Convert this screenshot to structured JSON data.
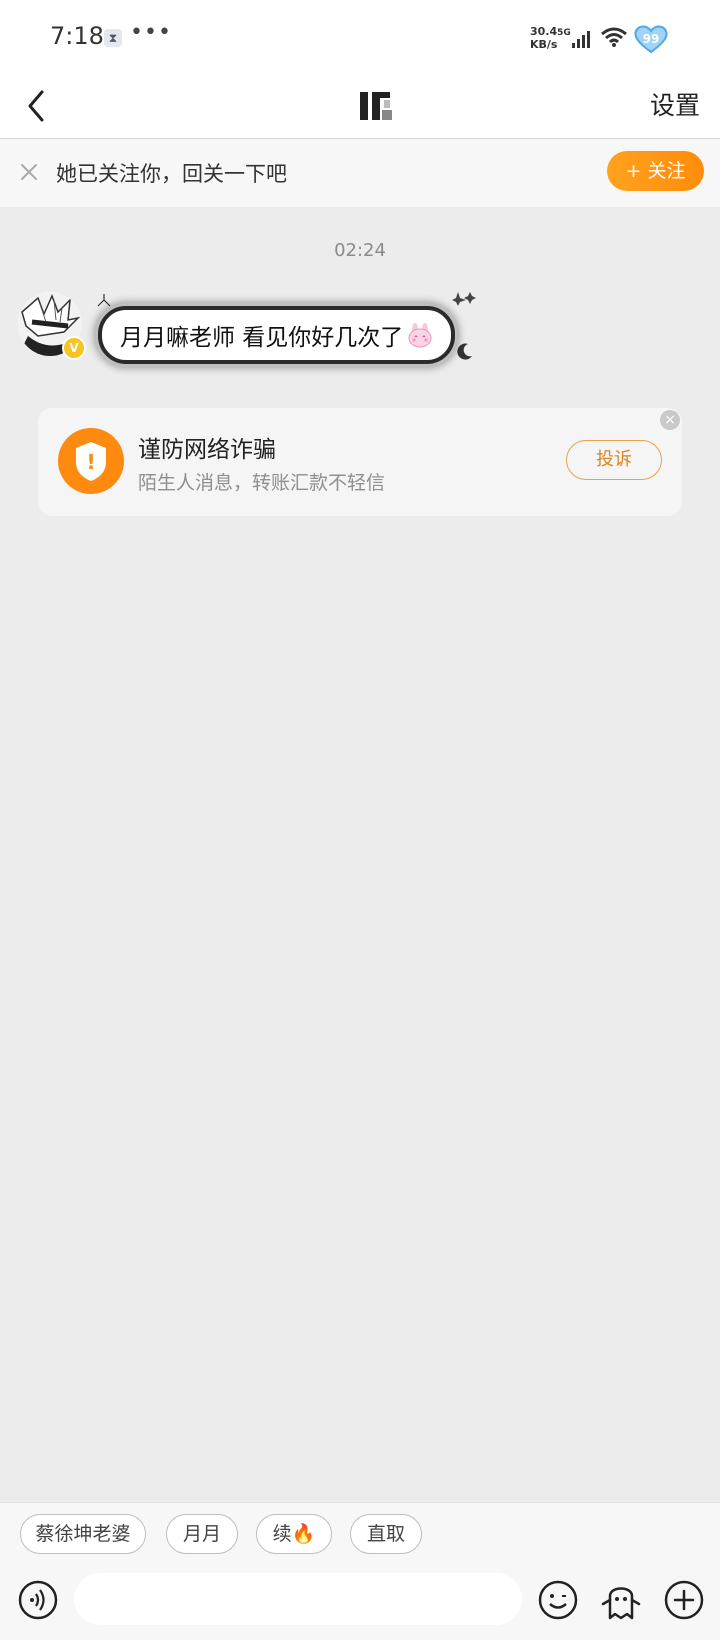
{
  "status_bar": {
    "time": "7:18",
    "hourglass_glyph": "⧗",
    "dots": "•••",
    "speed_value": "30.4",
    "speed_unit": "KB/s",
    "network": "5G",
    "battery": "99"
  },
  "nav": {
    "settings_label": "设置"
  },
  "follow_prompt": {
    "text": "她已关注你，回关一下吧",
    "follow_button": "+ 关注"
  },
  "chat": {
    "timestamp": "02:24",
    "messages": [
      {
        "text": "月月嘛老师 看见你好几次了"
      }
    ],
    "verified_badge": "V"
  },
  "fraud_card": {
    "title": "谨防网络诈骗",
    "subtitle": "陌生人消息，转账汇款不轻信",
    "report_button": "投诉",
    "icon_glyph": "!",
    "close_glyph": "×"
  },
  "quick_replies": [
    "蔡徐坤老婆",
    "月月",
    "续🔥",
    "直取"
  ],
  "input_bar": {
    "placeholder": ""
  },
  "colors": {
    "accent_orange": "#ff8c0a",
    "report_border": "#e7a24a",
    "background": "#ececec"
  },
  "icons": [
    "back-arrow-icon",
    "close-icon",
    "shield-icon",
    "voice-icon",
    "emoji-icon",
    "ghost-icon",
    "plus-icon",
    "wifi-icon",
    "signal-icon",
    "heart-battery-icon"
  ]
}
